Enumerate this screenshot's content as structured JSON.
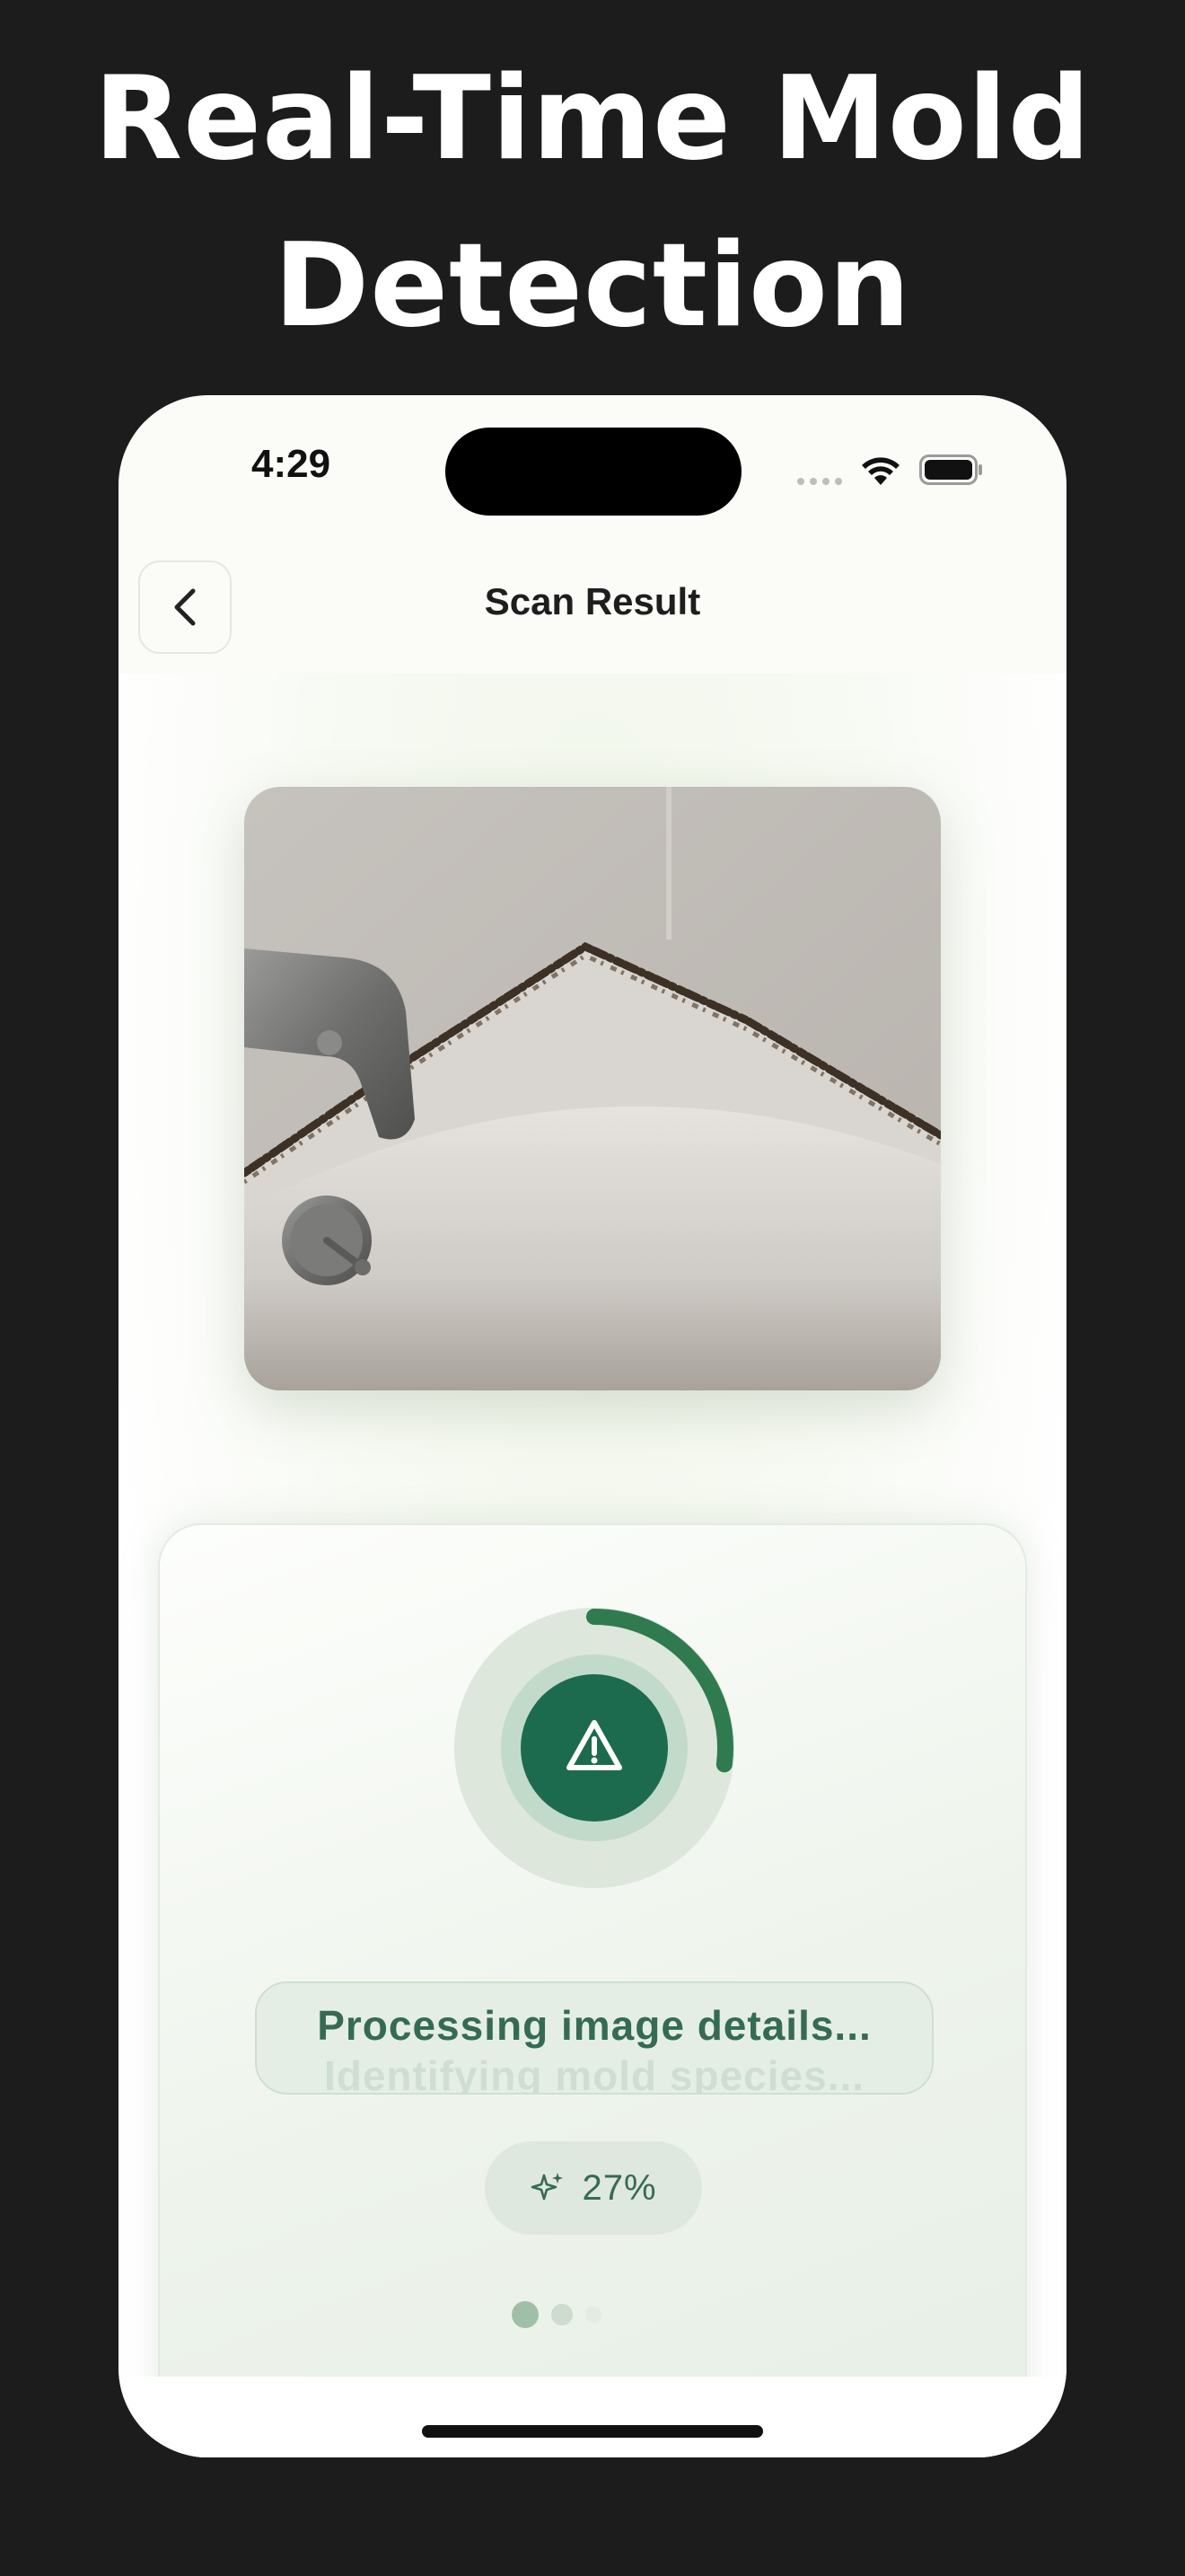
{
  "headline": {
    "line1": "Real-Time Mold",
    "line2": "Detection"
  },
  "status_bar": {
    "time": "4:29"
  },
  "nav": {
    "title": "Scan Result"
  },
  "scan": {
    "status_text": "Processing image details...",
    "next_status_text": "Identifying mold species...",
    "progress_percent": 27,
    "progress_label": "27%",
    "step_dots": {
      "total": 3,
      "active": 1
    }
  },
  "colors": {
    "accent": "#1c6b4f",
    "ring": "#2f7a4f",
    "page_background": "#1c1c1c"
  },
  "icons": {
    "back": "chevron-left-icon",
    "warning": "warning-triangle-icon",
    "sparkle": "sparkle-icon"
  }
}
